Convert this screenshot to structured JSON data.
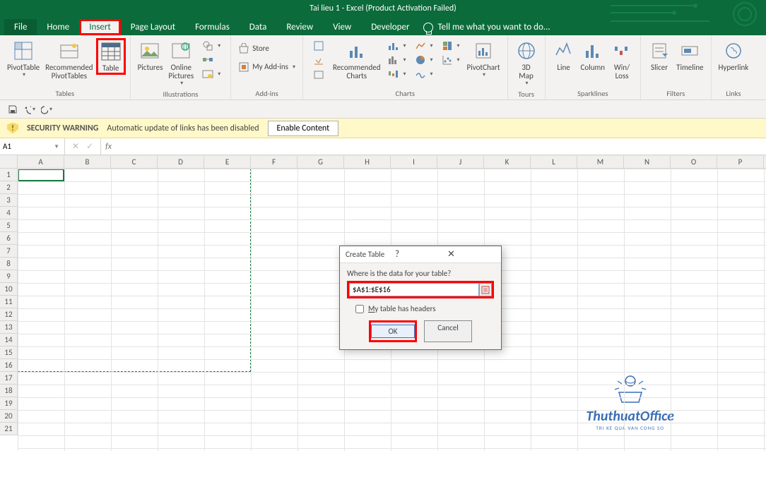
{
  "title": "Tai lieu 1 - Excel (Product Activation Failed)",
  "tabs": {
    "file": "File",
    "home": "Home",
    "insert": "Insert",
    "page_layout": "Page Layout",
    "formulas": "Formulas",
    "data": "Data",
    "review": "Review",
    "view": "View",
    "developer": "Developer",
    "tellme": "Tell me what you want to do..."
  },
  "ribbon": {
    "tables": {
      "pivottable": "PivotTable",
      "recommended_pivottables": "Recommended\nPivotTables",
      "table": "Table",
      "label": "Tables"
    },
    "illustrations": {
      "pictures": "Pictures",
      "online_pictures": "Online\nPictures",
      "label": "Illustrations"
    },
    "addins": {
      "store": "Store",
      "my_addins": "My Add-ins",
      "label": "Add-ins"
    },
    "charts": {
      "recommended": "Recommended\nCharts",
      "pivotchart": "PivotChart",
      "label": "Charts"
    },
    "tours": {
      "map": "3D\nMap",
      "label": "Tours"
    },
    "sparklines": {
      "line": "Line",
      "column": "Column",
      "winloss": "Win/\nLoss",
      "label": "Sparklines"
    },
    "filters": {
      "slicer": "Slicer",
      "timeline": "Timeline",
      "label": "Filters"
    },
    "links": {
      "hyperlink": "Hyperlink",
      "label": "Links"
    }
  },
  "msgbar": {
    "title": "SECURITY WARNING",
    "text": "Automatic update of links has been disabled",
    "button": "Enable Content"
  },
  "namebox": "A1",
  "fx": "fx",
  "dialog": {
    "title": "Create Table",
    "prompt": "Where is the data for your table?",
    "range": "$A$1:$E$16",
    "headers": "My table has headers",
    "ok": "OK",
    "cancel": "Cancel"
  },
  "columns": [
    "A",
    "B",
    "C",
    "D",
    "E",
    "F",
    "G",
    "H",
    "I",
    "J",
    "K",
    "L",
    "M",
    "N",
    "O",
    "P"
  ],
  "rows": [
    "1",
    "2",
    "3",
    "4",
    "5",
    "6",
    "7",
    "8",
    "9",
    "10",
    "11",
    "12",
    "13",
    "14",
    "15",
    "16",
    "17",
    "18",
    "19",
    "20",
    "21"
  ],
  "watermark": {
    "name": "ThuthuatOffice",
    "sub": "TRI KE QUA VAN CONG SO"
  }
}
